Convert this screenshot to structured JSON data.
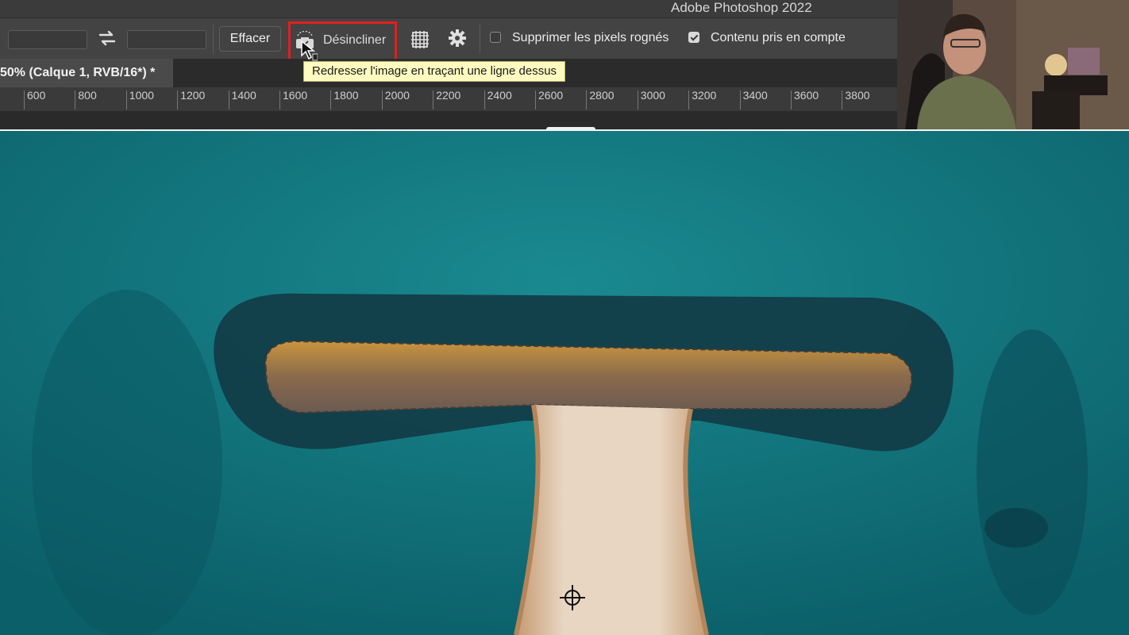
{
  "app": {
    "title": "Adobe Photoshop 2022"
  },
  "options_bar": {
    "clear_button": "Effacer",
    "straighten_tool": {
      "label": "Désincliner",
      "icon": "straighten-icon",
      "highlighted": true
    },
    "overlay_icon": "grid-overlay-icon",
    "settings_icon": "gear-icon",
    "delete_cropped_pixels": {
      "label": "Supprimer les pixels rognés",
      "checked": false
    },
    "content_aware": {
      "label": "Contenu pris en compte",
      "checked": true
    }
  },
  "document_tab": {
    "label": "50% (Calque 1, RVB/16*) *"
  },
  "tooltip": {
    "text": "Redresser l'image en traçant une ligne dessus"
  },
  "ruler": {
    "ticks": [
      "600",
      "800",
      "1000",
      "1200",
      "1400",
      "1600",
      "1800",
      "2000",
      "2200",
      "2400",
      "2600",
      "2800",
      "3000",
      "3200",
      "3400",
      "3600",
      "3800"
    ]
  },
  "colors": {
    "accent_highlight": "#e02020",
    "tooltip_bg": "#fffbc0",
    "panel_bg": "#434343",
    "sea": "#0f6c76"
  }
}
